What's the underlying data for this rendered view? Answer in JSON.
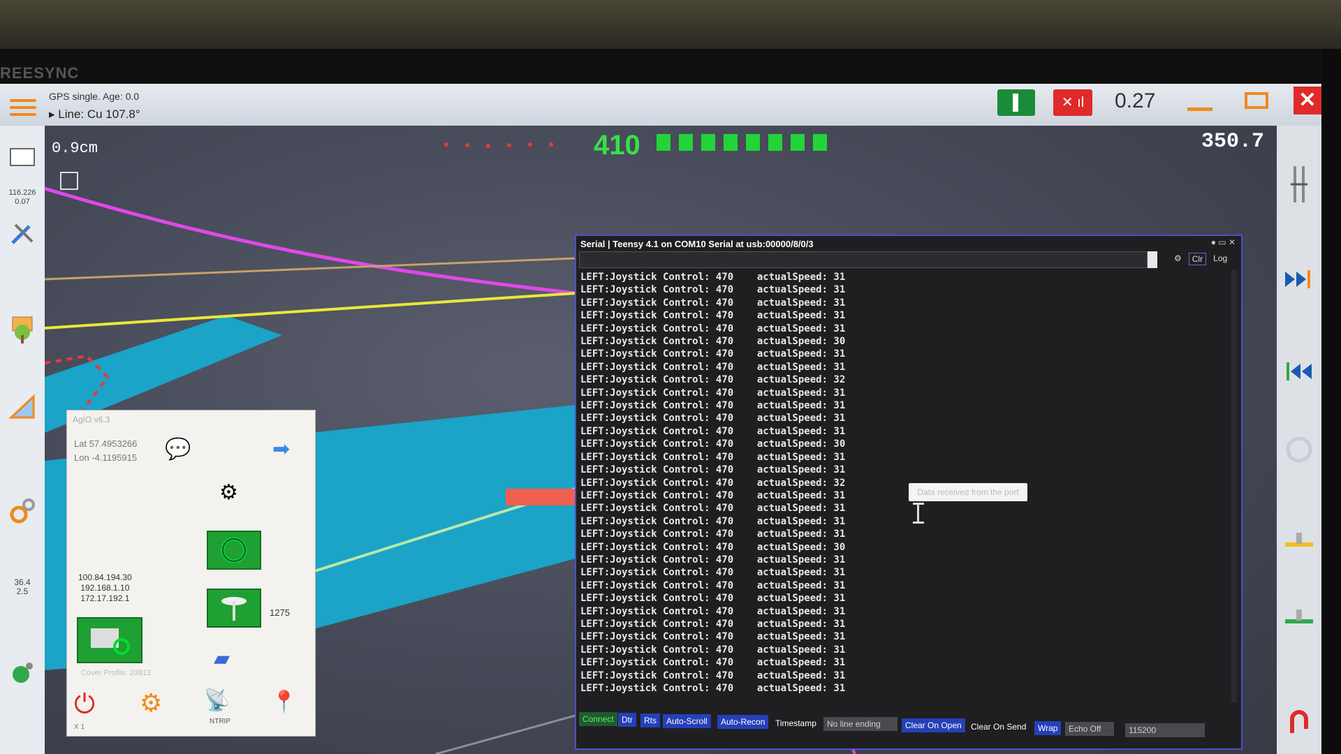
{
  "bezel": {
    "brand": "REESYNC"
  },
  "titlebar": {
    "gps_status": "GPS single. Age: 0.0",
    "line_status": "▸ Line: Cu 107.8°",
    "value": "0.27",
    "close": "✕",
    "red_icon": "✕ ıl"
  },
  "left_toolbar": {
    "small_top": "116.226\n0.07",
    "small_bottom": "36.4\n2.5"
  },
  "field": {
    "offset": "0.9cm",
    "speed": "410",
    "heading": "350.7",
    "lightbar_segments": 8
  },
  "serial": {
    "title": "Serial | Teensy 4.1 on COM10 Serial  at usb:00000/8/0/3",
    "window_buttons": "● ▭ ✕",
    "tools": [
      "Clr",
      "Log"
    ],
    "log_lines": [
      "LEFT:Joystick Control: 470    actualSpeed: 31",
      "LEFT:Joystick Control: 470    actualSpeed: 31",
      "LEFT:Joystick Control: 470    actualSpeed: 31",
      "LEFT:Joystick Control: 470    actualSpeed: 31",
      "LEFT:Joystick Control: 470    actualSpeed: 31",
      "LEFT:Joystick Control: 470    actualSpeed: 30",
      "LEFT:Joystick Control: 470    actualSpeed: 31",
      "LEFT:Joystick Control: 470    actualSpeed: 31",
      "LEFT:Joystick Control: 470    actualSpeed: 32",
      "LEFT:Joystick Control: 470    actualSpeed: 31",
      "LEFT:Joystick Control: 470    actualSpeed: 31",
      "LEFT:Joystick Control: 470    actualSpeed: 31",
      "LEFT:Joystick Control: 470    actualSpeed: 31",
      "LEFT:Joystick Control: 470    actualSpeed: 30",
      "LEFT:Joystick Control: 470    actualSpeed: 31",
      "LEFT:Joystick Control: 470    actualSpeed: 31",
      "LEFT:Joystick Control: 470    actualSpeed: 32",
      "LEFT:Joystick Control: 470    actualSpeed: 31",
      "LEFT:Joystick Control: 470    actualSpeed: 31",
      "LEFT:Joystick Control: 470    actualSpeed: 31",
      "LEFT:Joystick Control: 470    actualSpeed: 31",
      "LEFT:Joystick Control: 470    actualSpeed: 30",
      "LEFT:Joystick Control: 470    actualSpeed: 31",
      "LEFT:Joystick Control: 470    actualSpeed: 31",
      "LEFT:Joystick Control: 470    actualSpeed: 31",
      "LEFT:Joystick Control: 470    actualSpeed: 31",
      "LEFT:Joystick Control: 470    actualSpeed: 31",
      "LEFT:Joystick Control: 470    actualSpeed: 31",
      "LEFT:Joystick Control: 470    actualSpeed: 31",
      "LEFT:Joystick Control: 470    actualSpeed: 31",
      "LEFT:Joystick Control: 470    actualSpeed: 31",
      "LEFT:Joystick Control: 470    actualSpeed: 31",
      "LEFT:Joystick Control: 470    actualSpeed: 31"
    ],
    "tooltip": "Data received from the port",
    "bottom": {
      "connect": "Connect",
      "dtr": "Dtr",
      "rts": "Rts",
      "autoscroll": "Auto-Scroll",
      "autorecon": "Auto-Recon",
      "timestamp": "Timestamp",
      "line_ending": "No line ending",
      "clear_on_open": "Clear On Open",
      "clear_on_send": "Clear On Send",
      "wrap": "Wrap",
      "echo": "Echo Off",
      "baud": "115200"
    }
  },
  "agio": {
    "title": "AgIO v6.3",
    "lat": "Lat  57.4953266",
    "lon": "Lon  -4.1195915",
    "ips": "100.84.194.30\n192.168.1.10\n172.17.192.1",
    "count": "1275",
    "cover": "Cover Profile: 23812",
    "ntrip": "NTRIP",
    "bottom_label": "X 1"
  },
  "colors": {
    "accent_orange": "#f08a1c",
    "lightbar_green": "#22d43a",
    "serial_border": "#4a52c8",
    "close_red": "#e02a2a"
  }
}
